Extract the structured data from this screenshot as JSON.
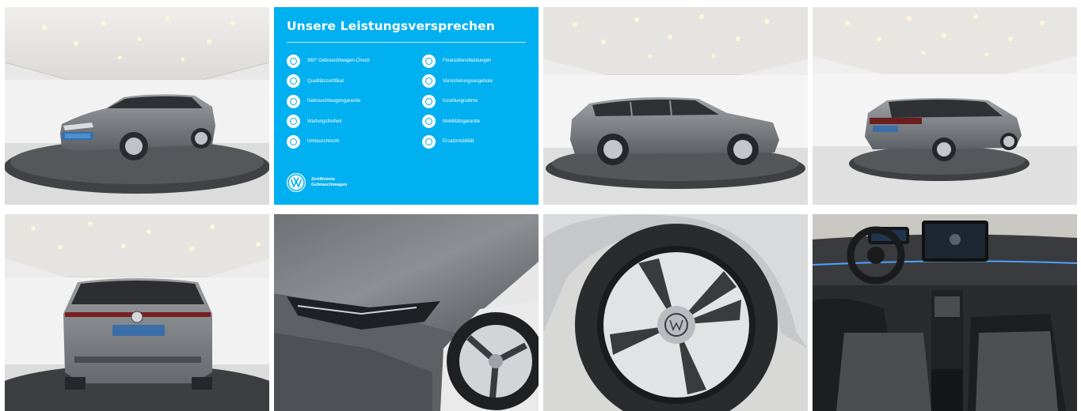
{
  "gallery": {
    "images": [
      {
        "view": "front-left three-quarter exterior in showroom on turntable"
      },
      {
        "view": "service promise panel"
      },
      {
        "view": "right side profile exterior on turntable"
      },
      {
        "view": "rear-left three-quarter exterior on turntable"
      },
      {
        "view": "rear view exterior on turntable"
      },
      {
        "view": "headlight and front fender close-up"
      },
      {
        "view": "alloy wheel close-up"
      },
      {
        "view": "interior dashboard and front seats"
      }
    ]
  },
  "promise_panel": {
    "title": "Unsere Leistungsversprechen",
    "items_left": [
      {
        "label": "360° Gebrauchtwagen-Check",
        "icon": "check-360-icon"
      },
      {
        "label": "Qualitätszertifikat",
        "icon": "certificate-icon"
      },
      {
        "label": "Gebrauchtwagengarantie",
        "icon": "shield-icon"
      },
      {
        "label": "Wartungsfreiheit",
        "icon": "wrench-icon"
      },
      {
        "label": "Umtauschrecht",
        "icon": "exchange-icon"
      }
    ],
    "items_right": [
      {
        "label": "Finanzdienstleistungen",
        "icon": "finance-icon"
      },
      {
        "label": "Versicherungsangebote",
        "icon": "insurance-icon"
      },
      {
        "label": "Inzahlungnahme",
        "icon": "trade-in-icon"
      },
      {
        "label": "Mobilitätsgarantie",
        "icon": "mobility-icon"
      },
      {
        "label": "Ersatzmobilität",
        "icon": "replacement-car-icon"
      }
    ],
    "badge_line1": "Zertifizierte",
    "badge_line2": "Gebrauchtwagen"
  },
  "colors": {
    "panel_blue": "#00b0f0",
    "car_grey": "#7a7d82",
    "showroom_white": "#e9e9e9",
    "turntable_dark": "#3a3c40"
  }
}
